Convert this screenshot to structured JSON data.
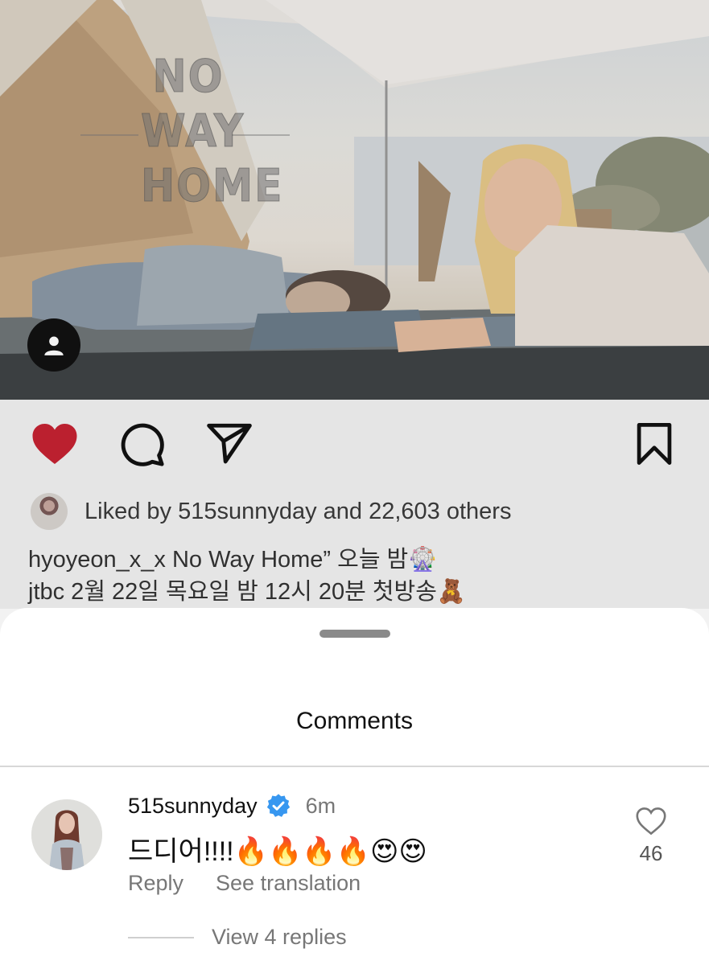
{
  "post": {
    "overlay_title": [
      "NO",
      "WAY",
      "HOME"
    ],
    "liked_by_text": "Liked by 515sunnyday and 22,603 others",
    "caption_line1": "hyoyeon_x_x No Way Home”  오늘 밤🎡",
    "caption_line2": "jtbc 2월 22일 목요일 밤 12시 20분 첫방송🧸"
  },
  "icons": {
    "like": "heart-filled-icon",
    "comment": "comment-bubble-icon",
    "share": "paper-plane-icon",
    "save": "bookmark-icon",
    "tag": "person-tag-icon"
  },
  "colors": {
    "like_red": "#c62232",
    "verified_blue": "#3797f0",
    "sheet_bg": "#ffffff",
    "muted_text": "#777777"
  },
  "comments_sheet": {
    "title": "Comments",
    "comment": {
      "username": "515sunnyday",
      "verified": true,
      "time": "6m",
      "text": "드디어!!!!🔥🔥🔥🔥😍😍",
      "reply_label": "Reply",
      "translate_label": "See translation",
      "like_count": "46",
      "view_replies": "View 4 replies"
    }
  }
}
